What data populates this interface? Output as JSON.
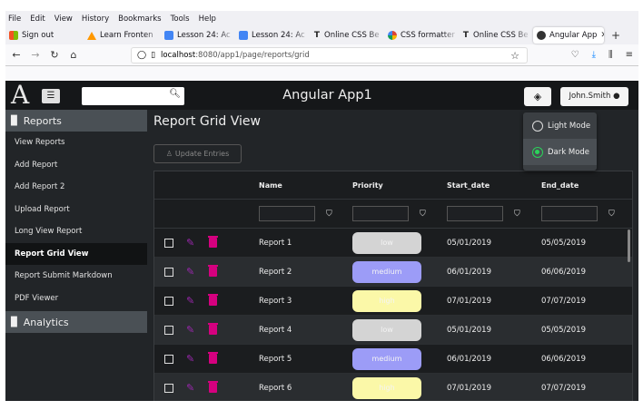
{
  "menubar": [
    "File",
    "Edit",
    "View",
    "History",
    "Bookmarks",
    "Tools",
    "Help"
  ],
  "tabs": [
    {
      "label": "Sign out",
      "icon": "windows-icon",
      "color": "#f35325"
    },
    {
      "label": "Learn Fronten",
      "icon": "triangle-icon",
      "color": "#ff9800"
    },
    {
      "label": "Lesson 24: Ac",
      "icon": "doc-icon",
      "color": "#4285f4"
    },
    {
      "label": "Lesson 24: Ac",
      "icon": "doc-icon",
      "color": "#4285f4"
    },
    {
      "label": "Online CSS Be",
      "icon": "t-icon",
      "color": "#222222"
    },
    {
      "label": "CSS formatter",
      "icon": "g-icon",
      "color": "#db4437"
    },
    {
      "label": "Online CSS Be",
      "icon": "t-icon",
      "color": "#222222"
    },
    {
      "label": "Angular App",
      "icon": "angular-icon",
      "color": "#333333",
      "active": true
    }
  ],
  "url": {
    "host": "localhost",
    "path": ":8080/app1/page/reports/grid"
  },
  "app": {
    "logo": "A",
    "title": "Angular App1",
    "user": "John.Smith",
    "search_placeholder": ""
  },
  "sidebar": {
    "section1": "Reports",
    "items": [
      "View Reports",
      "Add Report",
      "Add Report 2",
      "Upload Report",
      "Long View Report",
      "Report Grid View",
      "Report Submit Markdown",
      "PDF Viewer"
    ],
    "active": "Report Grid View",
    "section2": "Analytics"
  },
  "main": {
    "title": "Report Grid View",
    "update_button": "Update Entries"
  },
  "grid": {
    "columns": [
      "Name",
      "Priority",
      "Start_date",
      "End_date"
    ],
    "rows": [
      {
        "name": "Report 1",
        "priority": "low",
        "start": "05/01/2019",
        "end": "05/05/2019"
      },
      {
        "name": "Report 2",
        "priority": "medium",
        "start": "06/01/2019",
        "end": "06/06/2019"
      },
      {
        "name": "Report 3",
        "priority": "high",
        "start": "07/01/2019",
        "end": "07/07/2019"
      },
      {
        "name": "Report 4",
        "priority": "low",
        "start": "05/01/2019",
        "end": "05/05/2019"
      },
      {
        "name": "Report 5",
        "priority": "medium",
        "start": "06/01/2019",
        "end": "06/06/2019"
      },
      {
        "name": "Report 6",
        "priority": "high",
        "start": "07/01/2019",
        "end": "07/07/2019"
      }
    ]
  },
  "priority_colors": {
    "low": "#d4d4d4",
    "medium": "#9c9cf7",
    "high": "#fbf8a8"
  },
  "theme_menu": {
    "options": [
      "Light Mode",
      "Dark Mode"
    ],
    "selected": "Dark Mode"
  }
}
